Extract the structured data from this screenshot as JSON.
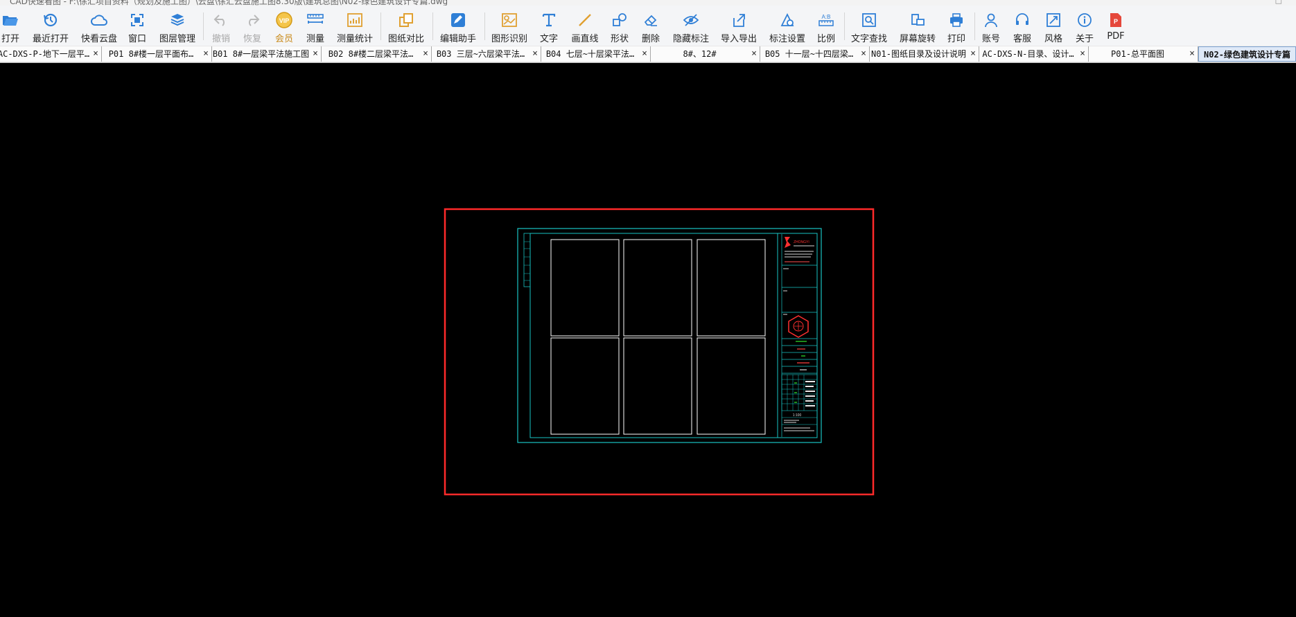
{
  "window": {
    "title": "CAD快速看图 - F:\\徐汇项目资料（规划及施工图）\\云盘\\徐汇云盘施工图8.30版\\建筑总图\\N02-绿色建筑设计专篇.dwg",
    "restore_glyph": "□"
  },
  "toolbar": {
    "items": [
      {
        "label": "打开",
        "icon": "folder-open-icon"
      },
      {
        "label": "最近打开",
        "icon": "recent-clock-icon"
      },
      {
        "label": "快看云盘",
        "icon": "cloud-icon"
      },
      {
        "label": "窗口",
        "icon": "window-fit-icon"
      },
      {
        "label": "图层管理",
        "icon": "layers-icon"
      },
      {
        "label": "撤销",
        "icon": "undo-icon"
      },
      {
        "label": "恢复",
        "icon": "redo-icon"
      },
      {
        "label": "会员",
        "icon": "vip-badge-icon"
      },
      {
        "label": "测量",
        "icon": "ruler-icon"
      },
      {
        "label": "测量统计",
        "icon": "measure-stats-icon"
      },
      {
        "label": "图纸对比",
        "icon": "compare-icon"
      },
      {
        "label": "编辑助手",
        "icon": "edit-assistant-icon"
      },
      {
        "label": "图形识别",
        "icon": "shape-recognition-icon"
      },
      {
        "label": "文字",
        "icon": "text-tool-icon"
      },
      {
        "label": "画直线",
        "icon": "line-tool-icon"
      },
      {
        "label": "形状",
        "icon": "shapes-icon"
      },
      {
        "label": "删除",
        "icon": "eraser-icon"
      },
      {
        "label": "隐藏标注",
        "icon": "eye-hide-icon"
      },
      {
        "label": "导入导出",
        "icon": "import-export-icon"
      },
      {
        "label": "标注设置",
        "icon": "annotation-settings-icon"
      },
      {
        "label": "比例",
        "icon": "scale-icon"
      },
      {
        "label": "文字查找",
        "icon": "text-search-icon"
      },
      {
        "label": "屏幕旋转",
        "icon": "rotate-screen-icon"
      },
      {
        "label": "打印",
        "icon": "printer-icon"
      },
      {
        "label": "账号",
        "icon": "account-icon"
      },
      {
        "label": "客服",
        "icon": "headset-icon"
      },
      {
        "label": "风格",
        "icon": "style-icon"
      },
      {
        "label": "关于",
        "icon": "info-icon"
      },
      {
        "label": "PDF",
        "icon": "pdf-icon"
      }
    ],
    "vip_text": "VIP",
    "scale_text": "A:B",
    "pdf_text": "P"
  },
  "tabs": [
    {
      "label": "AC-DXS-P-地下一层平…",
      "close": "×"
    },
    {
      "label": "P01 8#楼一层平面布…",
      "close": "×"
    },
    {
      "label": "B01 8#一层梁平法施工图",
      "close": "×"
    },
    {
      "label": "B02 8#楼二层梁平法…",
      "close": "×"
    },
    {
      "label": "B03 三层~六层梁平法…",
      "close": "×"
    },
    {
      "label": "B04 七层~十层梁平法…",
      "close": "×"
    },
    {
      "label": "8#、12#",
      "close": "×"
    },
    {
      "label": "B05 十一层~十四层梁…",
      "close": "×"
    },
    {
      "label": "N01-图纸目录及设计说明",
      "close": "×"
    },
    {
      "label": "AC-DXS-N-目录、设计…",
      "close": "×"
    },
    {
      "label": "P01-总平面图",
      "close": "×"
    },
    {
      "label": "N02-绿色建筑设计专篇",
      "close": "",
      "active": true
    }
  ],
  "drawing": {
    "highlight_color": "#ff2a2a",
    "frame_color": "#19c3c3",
    "logo_text": "ZHONGYI",
    "title_block_number": "1:100"
  }
}
